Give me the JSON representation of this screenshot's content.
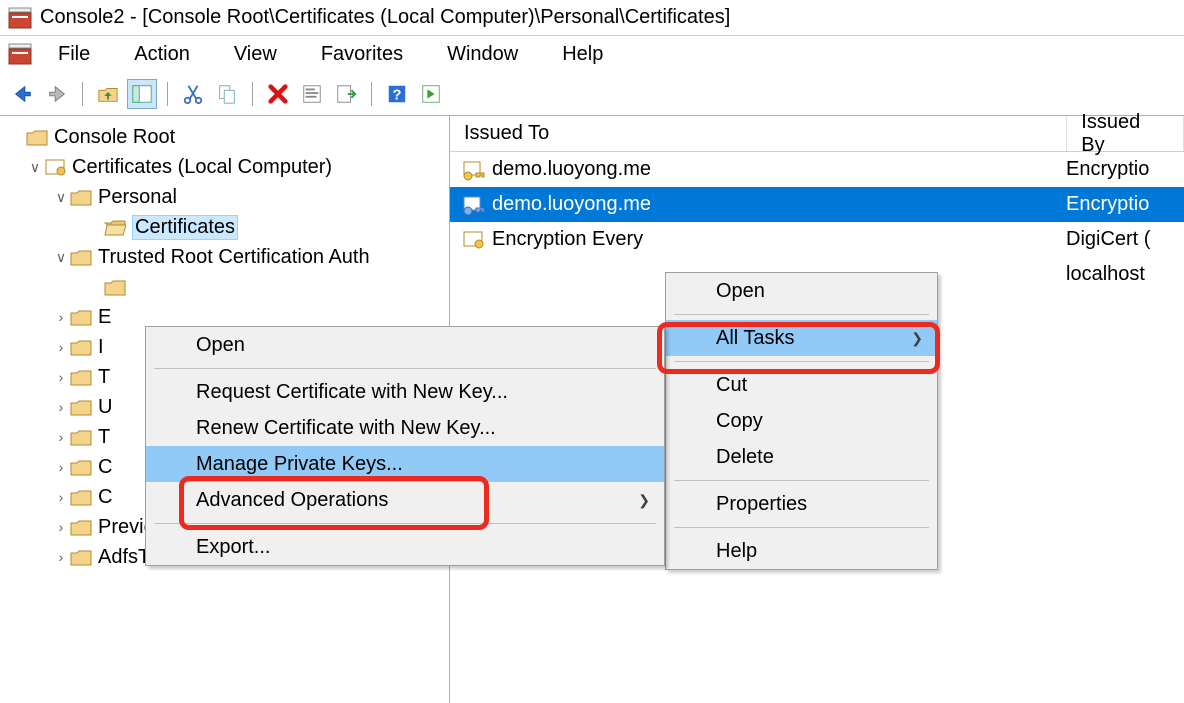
{
  "title": "Console2 - [Console Root\\Certificates (Local Computer)\\Personal\\Certificates]",
  "menu": {
    "file": "File",
    "action": "Action",
    "view": "View",
    "favorites": "Favorites",
    "window": "Window",
    "help": "Help"
  },
  "tree": {
    "root": "Console Root",
    "certs": "Certificates (Local Computer)",
    "personal": "Personal",
    "certificates": "Certificates",
    "trca": "Trusted Root Certification Auth",
    "rows": [
      "E",
      "I",
      "T",
      "U",
      "T",
      "C",
      "C"
    ],
    "preview": "Preview Build Roots",
    "adfs": "AdfsTrustedDevices"
  },
  "cols": {
    "issuedTo": "Issued To",
    "issuedBy": "Issued By"
  },
  "list": [
    {
      "to": "demo.luoyong.me",
      "by": "Encryptio"
    },
    {
      "to": "demo.luoyong.me",
      "by": "Encryptio"
    },
    {
      "to": "Encryption Every",
      "by": "DigiCert ("
    },
    {
      "to": "",
      "by": "localhost"
    }
  ],
  "menu1": {
    "open": "Open",
    "allTasks": "All Tasks",
    "cut": "Cut",
    "copy": "Copy",
    "delete": "Delete",
    "properties": "Properties",
    "help": "Help"
  },
  "menu2": {
    "open": "Open",
    "reqnew": "Request Certificate with New Key...",
    "rennew": "Renew Certificate with New Key...",
    "mpk": "Manage Private Keys...",
    "advops": "Advanced Operations",
    "export": "Export..."
  }
}
